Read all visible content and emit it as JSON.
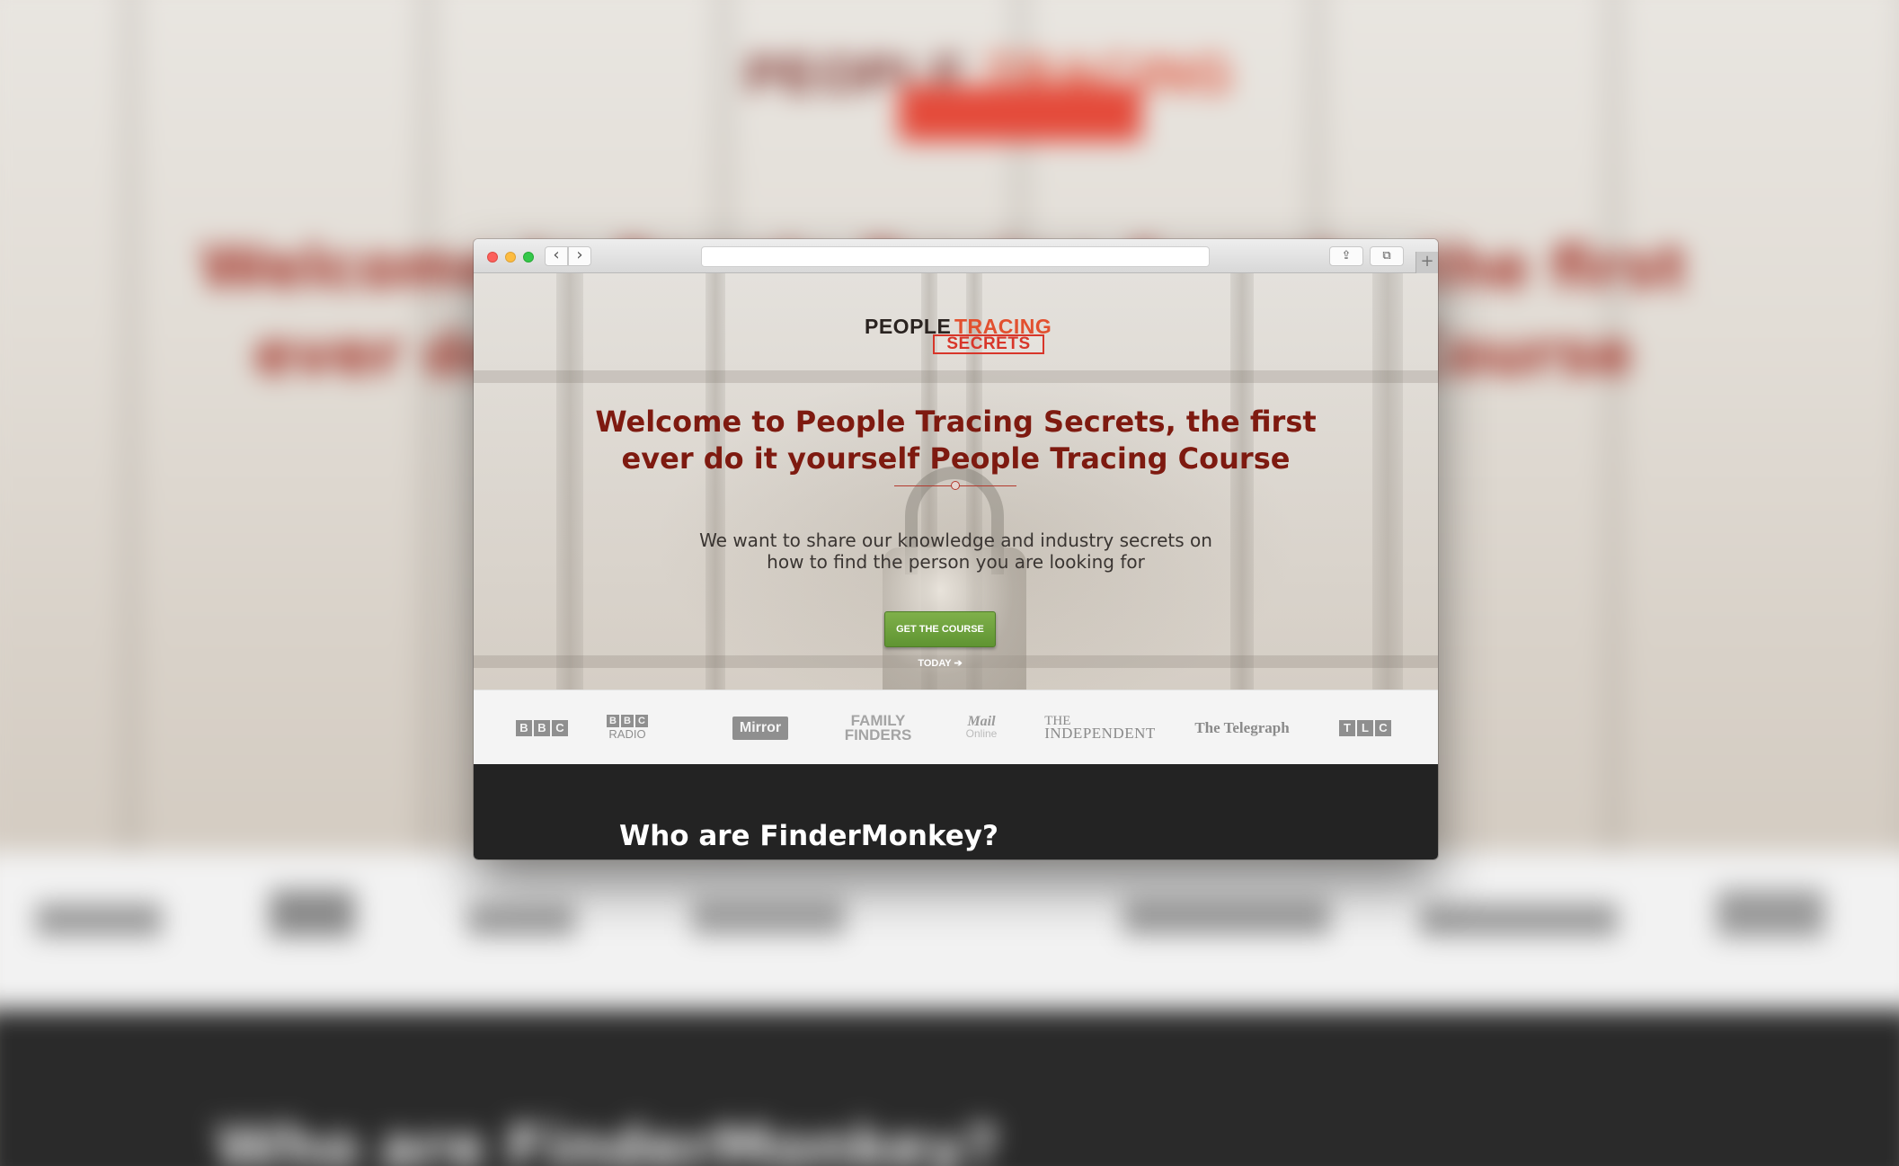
{
  "site": {
    "logo": {
      "people": "PEOPLE",
      "tracing": "TRACING",
      "secrets": "SECRETS"
    },
    "headline": "Welcome to People Tracing Secrets, the first ever do it yourself People Tracing Course",
    "subtext": "We want to share our knowledge and industry secrets on how to find the person you are looking for",
    "cta_label": "GET THE COURSE TODAY ➔",
    "press_logos": {
      "bbc": [
        "B",
        "B",
        "C"
      ],
      "bbc_radio": {
        "boxes": [
          "B",
          "B",
          "C"
        ],
        "text": "RADIO"
      },
      "mirror": "Mirror",
      "family_finders": [
        "FAMILY",
        "FINDERS"
      ],
      "mail_online": {
        "mail": "Mail",
        "online": "Online"
      },
      "independent": {
        "the": "THE",
        "name": "INDEPENDENT"
      },
      "telegraph": "The Telegraph",
      "tlc": [
        "T",
        "L",
        "C"
      ]
    },
    "section_title": "Who are FinderMonkey?"
  },
  "browser": {
    "icons": {
      "back": "chevron-left-icon",
      "forward": "chevron-right-icon",
      "share": "share-icon",
      "tabs": "tabs-icon",
      "new_tab": "plus-icon"
    }
  },
  "colors": {
    "headline": "#7e1a10",
    "cta": "#6ea23d",
    "dark_section": "#232323",
    "logo_red": "#d8362a"
  }
}
